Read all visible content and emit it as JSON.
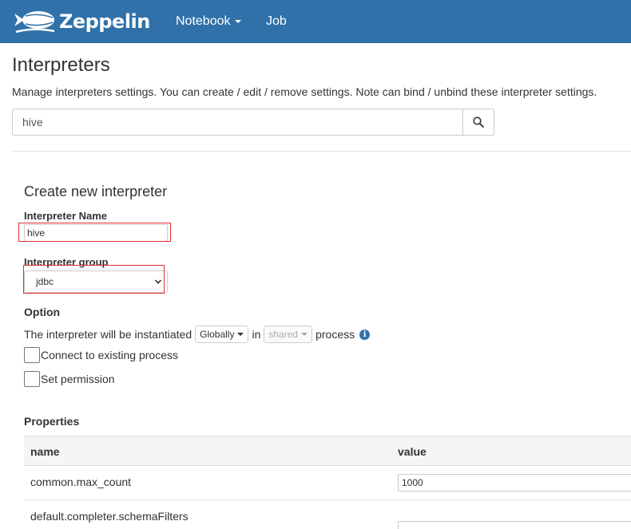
{
  "navbar": {
    "brand": "Zeppelin",
    "notebook_label": "Notebook",
    "job_label": "Job"
  },
  "page": {
    "title": "Interpreters",
    "description": "Manage interpreters settings. You can create / edit / remove settings. Note can bind / unbind these interpreter settings."
  },
  "search": {
    "value": "hive",
    "icon": "search-icon"
  },
  "create_form": {
    "title": "Create new interpreter",
    "name_label": "Interpreter Name",
    "name_value": "hive",
    "group_label": "Interpreter group",
    "group_value": "jdbc",
    "option_label": "Option",
    "instantiate_prefix": "The interpreter will be instantiated",
    "instantiate_scope": "Globally",
    "instantiate_in": "in",
    "instantiate_mode": "shared",
    "instantiate_suffix": "process",
    "connect_existing_label": "Connect to existing process",
    "set_permission_label": "Set permission",
    "highlight_color": "#e03030"
  },
  "properties": {
    "title": "Properties",
    "columns": [
      "name",
      "value"
    ],
    "rows": [
      {
        "name": "common.max_count",
        "value": "1000"
      },
      {
        "name": "default.completer.schemaFilters",
        "value": ""
      }
    ]
  },
  "colors": {
    "navbar": "#3071a9",
    "info_icon": "#3071a9"
  }
}
